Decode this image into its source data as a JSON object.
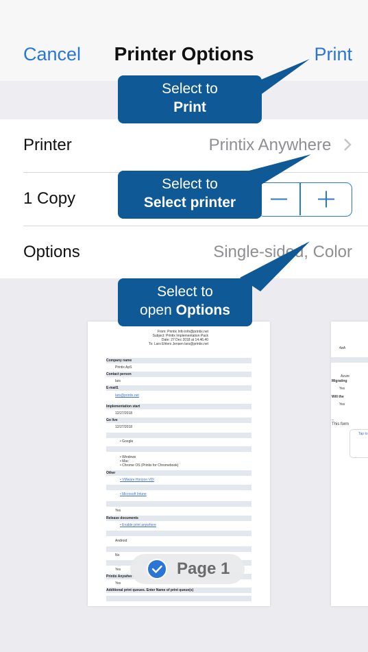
{
  "navbar": {
    "cancel": "Cancel",
    "title": "Printer Options",
    "print": "Print"
  },
  "rows": {
    "printer": {
      "label": "Printer",
      "value": "Printix Anywhere"
    },
    "copies": {
      "label": "1 Copy",
      "minus": "—",
      "plus": "+"
    },
    "options": {
      "label": "Options",
      "value": "Single-sided, Color"
    }
  },
  "tooltips": [
    {
      "line1": "Select to",
      "line2": "Print"
    },
    {
      "line1": "Select to",
      "line2": "Select printer"
    },
    {
      "line1": "Select to",
      "line2_prefix": "open ",
      "line2": "Options"
    }
  ],
  "preview": {
    "page_badge": "Page 1",
    "header": {
      "from": "From: Printix Info info@printix.net",
      "subject": "Subject: Printix Implementation Pack",
      "date": "Date: 27 Dec 2018 at 14.46.40",
      "to": "To: Lars Ehlers Jensen lars@printix.net"
    },
    "form": [
      {
        "label": "Company name",
        "value": "Printix ApS"
      },
      {
        "label": "Contact person",
        "value": "lars"
      },
      {
        "label": "E-mail1",
        "value": "lars@printix.net"
      },
      {
        "label": "Implementation start",
        "value": "12/27/2018"
      },
      {
        "label": "Go live",
        "value": "12/27/2018"
      }
    ],
    "bullets": [
      "Google",
      "Windows",
      "Mac",
      "Chrome OS (Printix for Chromebook)"
    ],
    "other_label": "Other",
    "other_bullets": [
      "VMware Horizon VDI",
      "Microsoft Intune"
    ],
    "yes": "Yes",
    "release_label": "Release documents",
    "release_bullet": "Enable print anywhere",
    "android": "Android",
    "no": "No",
    "yes2": "Yes",
    "anywhere_label": "Printix Anywhere",
    "yes3": "Yes",
    "additional": "Additional print queues. Enter Name of print queue(s)",
    "page2": {
      "r1": "4øA",
      "r2": "Azure",
      "r3": "Migrating",
      "r4": "Yes",
      "r5": "Will the",
      "r6": "Yes",
      "r7": "--",
      "r8": "This form",
      "r9": "Tap to"
    }
  }
}
